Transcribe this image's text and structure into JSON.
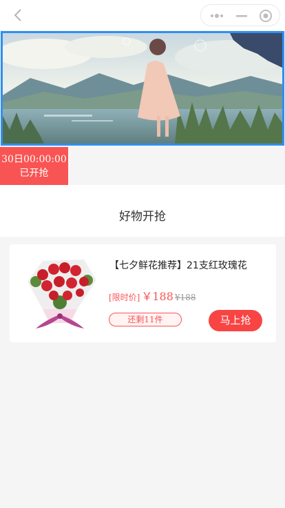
{
  "nav": {
    "back_icon": "chevron-left-icon",
    "capsule_icons": [
      "more-dots-icon",
      "minimize-icon",
      "target-icon"
    ]
  },
  "banner": {
    "image": "anime-girl-lake-landscape"
  },
  "flash_sale": {
    "time": "30日00:00:00",
    "status": "已开抢",
    "color": "#f95454"
  },
  "section": {
    "title": "好物开抢"
  },
  "product": {
    "title": "【七夕鲜花推荐】21支红玫瑰花",
    "price_label": "[限时价]",
    "price": "￥188",
    "original_price": "¥188",
    "stock": "还剩11件",
    "buy_label": "马上抢",
    "image": "red-rose-bouquet"
  },
  "colors": {
    "accent": "#f95454",
    "banner_border": "#2f8ff2"
  }
}
